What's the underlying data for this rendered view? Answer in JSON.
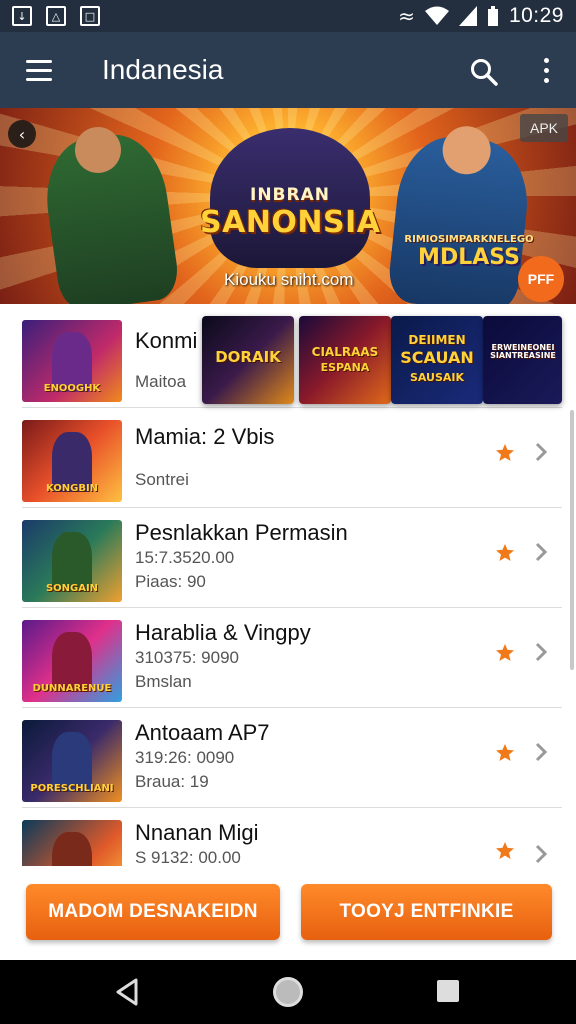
{
  "status_bar": {
    "time": "10:29",
    "left_icons": [
      "download-icon",
      "image-icon",
      "notification-icon"
    ],
    "right_icons": [
      "vibrate-icon",
      "wifi-icon",
      "signal-icon",
      "battery-icon"
    ]
  },
  "app_bar": {
    "title": "Indanesia",
    "icons": [
      "menu-icon",
      "search-icon",
      "more-vert-icon"
    ],
    "color": "#2d3d51"
  },
  "banner": {
    "logo_top": "INBRAN",
    "logo_main": "SANONSIA",
    "site": "Kiouku sniht.com",
    "logo2_small": "RIMIOSIMPARKNELEGO",
    "logo2_main": "MDLASS",
    "tag": "APK",
    "badge": "PFF"
  },
  "list": {
    "items": [
      {
        "title": "Konmi",
        "sub1": "Maitoa",
        "sub2": "",
        "thumb_caption": "ENOOGHK",
        "starred": false
      },
      {
        "title": "Mamia: 2 Vbis",
        "sub1": "Sontrei",
        "sub2": "",
        "thumb_caption": "KONGBIN",
        "starred": true
      },
      {
        "title": "Pesnlakkan Permasin",
        "sub1": "15:7.3520.00",
        "sub2": "Piaas: 90",
        "thumb_caption": "SONGAIN",
        "starred": true
      },
      {
        "title": "Harablia & Vingpy",
        "sub1": "310375: 9090",
        "sub2": "Bmslan",
        "thumb_caption": "DUNNARENUE",
        "starred": true
      },
      {
        "title": "Antoaam AP7",
        "sub1": "319:26: 0090",
        "sub2": "Braua: 19",
        "thumb_caption": "PORESCHLIANI",
        "starred": true
      },
      {
        "title": "Nnanan Migi",
        "sub1": "S 9132: 00.00",
        "sub2": "",
        "thumb_caption": "",
        "starred": true
      }
    ]
  },
  "popups": [
    {
      "text": "DORAIK"
    },
    {
      "text_top": "CIALRAAS",
      "text_bottom": "ESPANA"
    },
    {
      "text_top": "DEIIMEN",
      "text_main": "SCAUAN",
      "text_bottom": "SAUSAIK"
    },
    {
      "text": "ERWEINEONEISIANTREASINE"
    }
  ],
  "buttons": {
    "left_label": "MADOM DESNAKEIDN",
    "right_label": "TOOYJ ENTFINKIE",
    "color": "#e7600f"
  },
  "navbar": {
    "icons": [
      "back-icon",
      "home-icon",
      "recent-apps-icon"
    ]
  }
}
